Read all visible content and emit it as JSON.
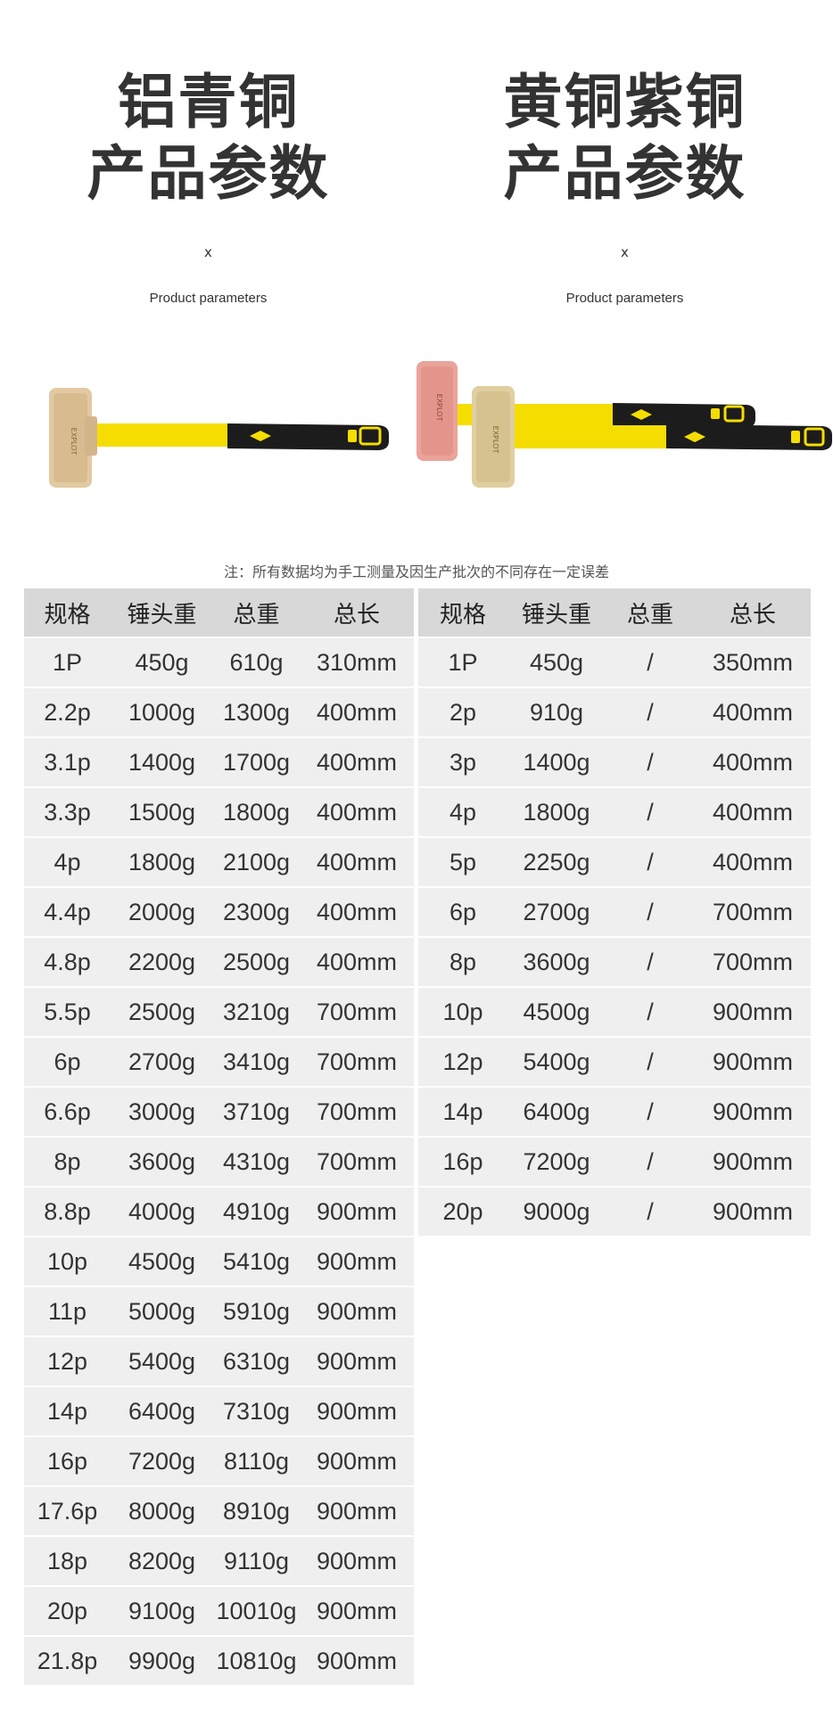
{
  "left_heading": {
    "title_line1": "铝青铜",
    "title_line2": "产品参数",
    "x_mark": "x",
    "subtitle": "Product parameters"
  },
  "right_heading": {
    "title_line1": "黄铜紫铜",
    "title_line2": "产品参数",
    "x_mark": "x",
    "subtitle": "Product parameters"
  },
  "colors": {
    "aluminum_bronze_head": "#e2c9a2",
    "brass_head": "#e0cfa0",
    "copper_head": "#eaa39a",
    "handle_yellow": "#f5dd00",
    "grip_black": "#1c1c1c"
  },
  "note": "注：所有数据均为手工测量及因生产批次的不同存在一定误差",
  "left_table": {
    "headers": [
      "规格",
      "锤头重",
      "总重",
      "总长"
    ],
    "rows": [
      [
        "1P",
        "450g",
        "610g",
        "310mm"
      ],
      [
        "2.2p",
        "1000g",
        "1300g",
        "400mm"
      ],
      [
        "3.1p",
        "1400g",
        "1700g",
        "400mm"
      ],
      [
        "3.3p",
        "1500g",
        "1800g",
        "400mm"
      ],
      [
        "4p",
        "1800g",
        "2100g",
        "400mm"
      ],
      [
        "4.4p",
        "2000g",
        "2300g",
        "400mm"
      ],
      [
        "4.8p",
        "2200g",
        "2500g",
        "400mm"
      ],
      [
        "5.5p",
        "2500g",
        "3210g",
        "700mm"
      ],
      [
        "6p",
        "2700g",
        "3410g",
        "700mm"
      ],
      [
        "6.6p",
        "3000g",
        "3710g",
        "700mm"
      ],
      [
        "8p",
        "3600g",
        "4310g",
        "700mm"
      ],
      [
        "8.8p",
        "4000g",
        "4910g",
        "900mm"
      ],
      [
        "10p",
        "4500g",
        "5410g",
        "900mm"
      ],
      [
        "11p",
        "5000g",
        "5910g",
        "900mm"
      ],
      [
        "12p",
        "5400g",
        "6310g",
        "900mm"
      ],
      [
        "14p",
        "6400g",
        "7310g",
        "900mm"
      ],
      [
        "16p",
        "7200g",
        "8110g",
        "900mm"
      ],
      [
        "17.6p",
        "8000g",
        "8910g",
        "900mm"
      ],
      [
        "18p",
        "8200g",
        "9110g",
        "900mm"
      ],
      [
        "20p",
        "9100g",
        "10010g",
        "900mm"
      ],
      [
        "21.8p",
        "9900g",
        "10810g",
        "900mm"
      ]
    ]
  },
  "right_table": {
    "headers": [
      "规格",
      "锤头重",
      "总重",
      "总长"
    ],
    "rows": [
      [
        "1P",
        "450g",
        "/",
        "350mm"
      ],
      [
        "2p",
        "910g",
        "/",
        "400mm"
      ],
      [
        "3p",
        "1400g",
        "/",
        "400mm"
      ],
      [
        "4p",
        "1800g",
        "/",
        "400mm"
      ],
      [
        "5p",
        "2250g",
        "/",
        "400mm"
      ],
      [
        "6p",
        "2700g",
        "/",
        "700mm"
      ],
      [
        "8p",
        "3600g",
        "/",
        "700mm"
      ],
      [
        "10p",
        "4500g",
        "/",
        "900mm"
      ],
      [
        "12p",
        "5400g",
        "/",
        "900mm"
      ],
      [
        "14p",
        "6400g",
        "/",
        "900mm"
      ],
      [
        "16p",
        "7200g",
        "/",
        "900mm"
      ],
      [
        "20p",
        "9000g",
        "/",
        "900mm"
      ]
    ]
  }
}
